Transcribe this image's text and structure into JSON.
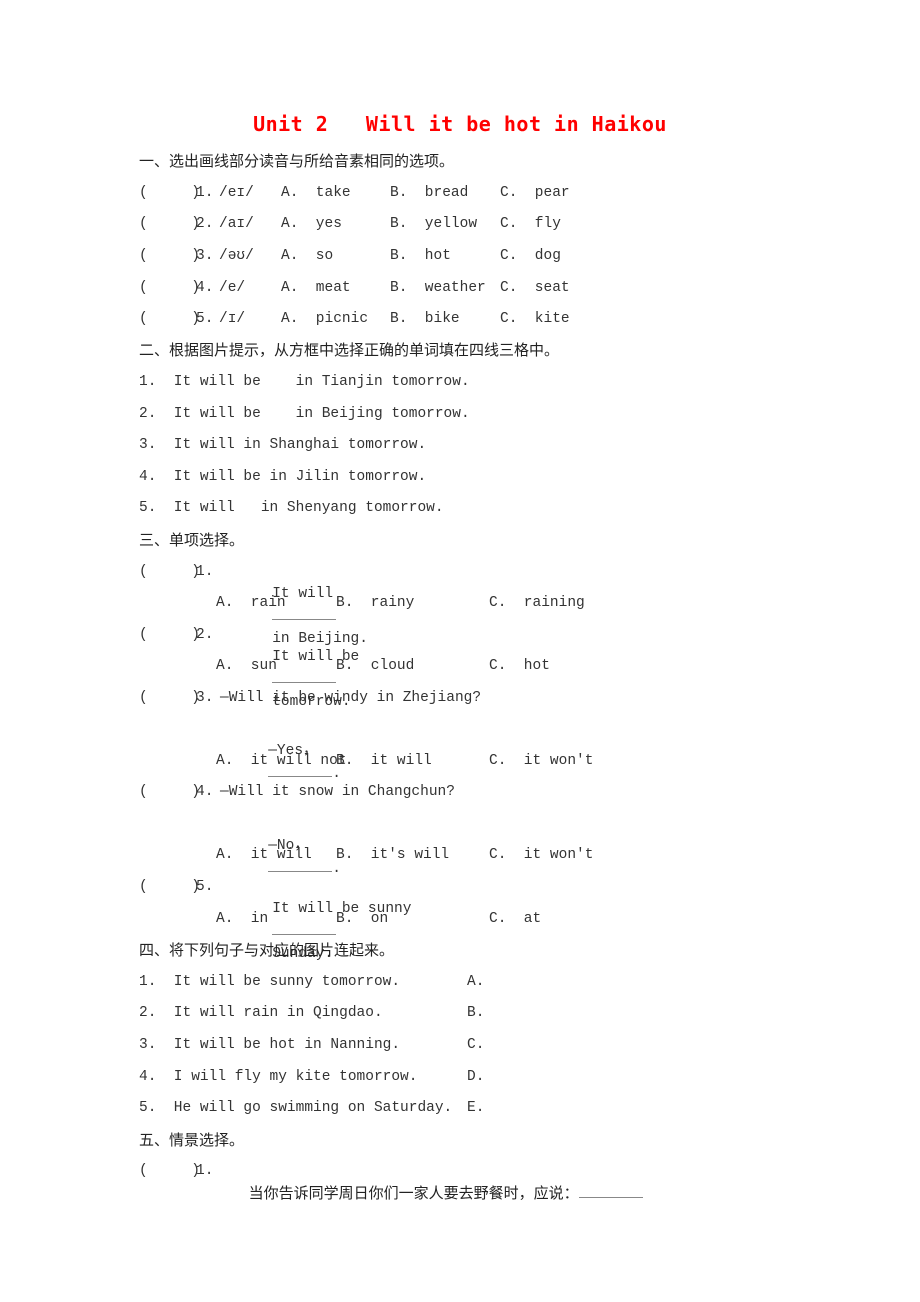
{
  "title": "Unit 2   Will it be hot in Haikou",
  "section1": {
    "heading": "一、选出画线部分读音与所给音素相同的选项。",
    "items": [
      {
        "paren": "(     )",
        "num": "1.",
        "phoneme": "/eɪ/",
        "a": "A.  take",
        "b": "B.  bread",
        "c": "C.  pear"
      },
      {
        "paren": "(     )",
        "num": "2.",
        "phoneme": "/aɪ/",
        "a": "A.  yes",
        "b": "B.  yellow",
        "c": "C.  fly"
      },
      {
        "paren": "(     )",
        "num": "3.",
        "phoneme": "/əʊ/",
        "a": "A.  so",
        "b": "B.  hot",
        "c": "C.  dog"
      },
      {
        "paren": "(     )",
        "num": "4.",
        "phoneme": "/e/",
        "a": "A.  meat",
        "b": "B.  weather",
        "c": "C.  seat"
      },
      {
        "paren": "(     )",
        "num": "5.",
        "phoneme": "/ɪ/",
        "a": "A.  picnic",
        "b": "B.  bike",
        "c": "C.  kite"
      }
    ]
  },
  "section2": {
    "heading": "二、根据图片提示，从方框中选择正确的单词填在四线三格中。",
    "items": [
      "1.  It will be    in Tianjin tomorrow.",
      "2.  It will be    in Beijing tomorrow.",
      "3.  It will in Shanghai tomorrow.",
      "4.  It will be in Jilin tomorrow.",
      "5.  It will   in Shenyang tomorrow."
    ]
  },
  "section3": {
    "heading": "三、单项选择。",
    "items": [
      {
        "paren": "(     )",
        "num": "1.",
        "stem_before": "It will",
        "stem_after": "in Beijing.",
        "a": "A.  rain",
        "b": "B.  rainy",
        "c": "C.  raining"
      },
      {
        "paren": "(     )",
        "num": "2.",
        "stem_before": "It will be",
        "stem_after": "tomorrow.",
        "a": "A.  sun",
        "b": "B.  cloud",
        "c": "C.  hot"
      },
      {
        "paren": "(     )",
        "num": "3.",
        "question": "—Will it be windy in Zhejiang?",
        "answer_before": "—Yes，",
        "answer_after": ".",
        "a": "A.  it will not",
        "b": "B.  it will",
        "c": "C.  it won't"
      },
      {
        "paren": "(     )",
        "num": "4.",
        "question": "—Will it snow in Changchun?",
        "answer_before": "—No，",
        "answer_after": ".",
        "a": "A.  it will",
        "b": "B.  it's will",
        "c": "C.  it won't"
      },
      {
        "paren": "(     )",
        "num": "5.",
        "stem_before": "It will be sunny",
        "stem_after": "Sunday.",
        "a": "A.  in",
        "b": "B.  on",
        "c": "C.  at"
      }
    ]
  },
  "section4": {
    "heading": "四、将下列句子与对应的图片连起来。",
    "items": [
      {
        "sentence": "1.  It will be sunny tomorrow.",
        "letter": "A."
      },
      {
        "sentence": "2.  It will rain in Qingdao.",
        "letter": "B."
      },
      {
        "sentence": "3.  It will be hot in Nanning.",
        "letter": "C."
      },
      {
        "sentence": "4.  I will fly my kite tomorrow.",
        "letter": "D."
      },
      {
        "sentence": "5.  He will go swimming on Saturday.",
        "letter": "E."
      }
    ]
  },
  "section5": {
    "heading": "五、情景选择。",
    "items": [
      {
        "paren": "(     )",
        "num": "1.",
        "text": "当你告诉同学周日你们一家人要去野餐时，应说："
      }
    ]
  }
}
